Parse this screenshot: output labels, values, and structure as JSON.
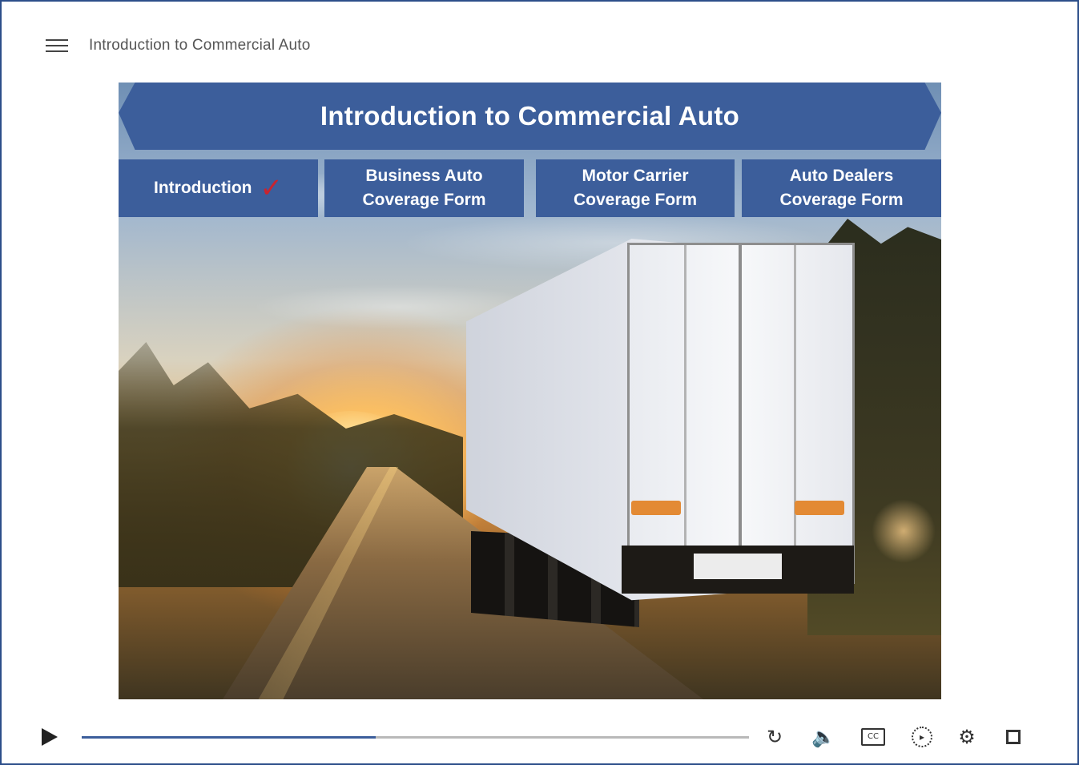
{
  "header": {
    "menu_icon": "hamburger-menu-icon",
    "course_title": "Introduction to Commercial Auto"
  },
  "slide": {
    "banner_title": "Introduction to Commercial Auto",
    "background_image": "white semi-truck trailer on road at sunset",
    "tabs": [
      {
        "line1": "Introduction",
        "line2": "",
        "completed": true,
        "check_icon": "checkmark-icon"
      },
      {
        "line1": "Business Auto",
        "line2": "Coverage Form",
        "completed": false
      },
      {
        "line1": "Motor Carrier",
        "line2": "Coverage Form",
        "completed": false
      },
      {
        "line1": "Auto Dealers",
        "line2": "Coverage Form",
        "completed": false
      }
    ],
    "colors": {
      "tab_bg": "#3c5e9b",
      "check": "#c8242f"
    }
  },
  "player": {
    "play_icon": "play-icon",
    "progress_fraction": 0.44,
    "icons": [
      "replay-icon",
      "volume-icon",
      "closed-captions-icon",
      "playback-speed-icon",
      "settings-gear-icon",
      "fullscreen-icon"
    ],
    "accent": "#3c5e9b"
  }
}
